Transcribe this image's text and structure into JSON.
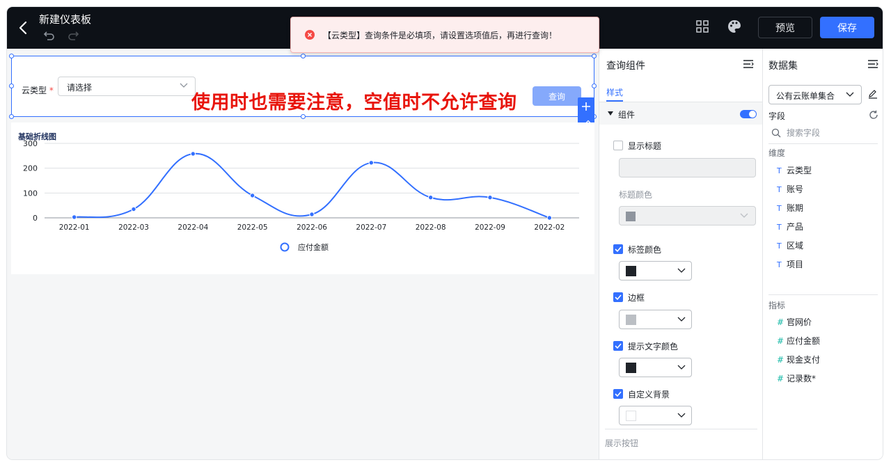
{
  "header": {
    "title": "新建仪表板",
    "preview_label": "预览",
    "save_label": "保存"
  },
  "toast": {
    "message": "【云类型】查询条件是必填项，请设置选项值后，再进行查询！"
  },
  "query": {
    "field_label": "云类型",
    "required_mark": "*",
    "select_placeholder": "请选择",
    "button_label": "查询"
  },
  "annotation": "使用时也需要注意，空值时不允许查询",
  "chart": {
    "title": "基础折线图"
  },
  "chart_data": {
    "type": "line",
    "title": "基础折线图",
    "categories": [
      "2022-01",
      "2022-03",
      "2022-04",
      "2022-05",
      "2022-06",
      "2022-07",
      "2022-08",
      "2022-09",
      "2022-02"
    ],
    "series": [
      {
        "name": "应付金额",
        "values": [
          3,
          35,
          258,
          90,
          14,
          222,
          82,
          82,
          0
        ],
        "color": "#3370ff"
      }
    ],
    "ylim": [
      0,
      300
    ],
    "yticks": [
      0,
      100,
      200,
      300
    ],
    "grid": true,
    "smooth": true,
    "legend": "bottom-center"
  },
  "panel": {
    "title": "查询组件",
    "tab_style": "样式",
    "group_label": "组件",
    "show_title": {
      "label": "显示标题",
      "checked": false
    },
    "title_color_label": "标题颜色",
    "title_color": "#8f959e",
    "label_color": {
      "label": "标签颜色",
      "checked": true,
      "color": "#1f2329"
    },
    "border": {
      "label": "边框",
      "checked": true,
      "color": "#bbbfc4"
    },
    "hint_color": {
      "label": "提示文字颜色",
      "checked": true,
      "color": "#1f2329"
    },
    "custom_bg": {
      "label": "自定义背景",
      "checked": true,
      "color": "#ffffff"
    },
    "section_buttons": "展示按钮"
  },
  "dataset": {
    "title": "数据集",
    "selected": "公有云账单集合",
    "fields_label": "字段",
    "search_placeholder": "搜索字段",
    "dimension_label": "维度",
    "dimensions": [
      "云类型",
      "账号",
      "账期",
      "产品",
      "区域",
      "项目"
    ],
    "dimension_icon": "T",
    "metric_label": "指标",
    "metrics": [
      "官网价",
      "应付金额",
      "现金支付",
      "记录数*"
    ],
    "metric_icon": "#"
  },
  "colors": {
    "accent": "#3370ff",
    "topbar": "#0d1117",
    "error": "#f54a45",
    "annotation": "#e8150c"
  }
}
